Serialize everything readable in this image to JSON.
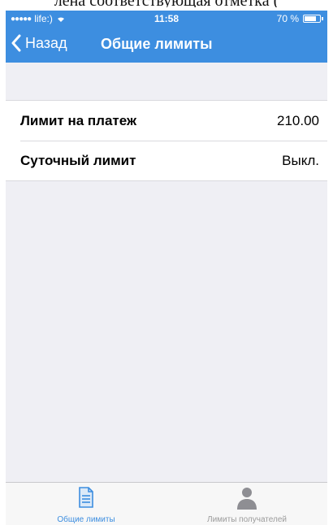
{
  "caption": "лена соответствующая отметка (",
  "status_bar": {
    "carrier": "life:)",
    "time": "11:58",
    "battery": "70 %"
  },
  "nav": {
    "back_label": "Назад",
    "title": "Общие лимиты"
  },
  "limits": [
    {
      "label": "Лимит на платеж",
      "value": "210.00"
    },
    {
      "label": "Суточный лимит",
      "value": "Выкл."
    }
  ],
  "tabs": [
    {
      "label": "Общие лимиты",
      "icon": "document-icon",
      "active": true
    },
    {
      "label": "Лимиты получателей",
      "icon": "person-icon",
      "active": false
    }
  ],
  "colors": {
    "accent": "#3d8ee0",
    "background": "#efeff4",
    "inactive": "#9b9b9b"
  }
}
